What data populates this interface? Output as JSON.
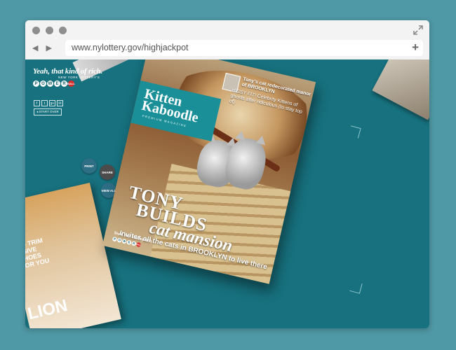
{
  "browser": {
    "url": "www.nylottery.gov/highjackpot",
    "back_icon": "chevron-left-icon",
    "forward_icon": "chevron-right-icon",
    "new_tab_label": "+"
  },
  "brand": {
    "tagline": "Yeah, that kind of rich.",
    "subline": "NEW YORK LOTTERY'S",
    "powerball_letters": [
      "P",
      "O",
      "W",
      "E",
      "R"
    ],
    "ball_label": "BALL",
    "start_over": "◂ START OVER",
    "social": [
      "f",
      "t",
      "g+",
      "✉"
    ]
  },
  "actions": {
    "print": "PRINT",
    "share": "SHARE",
    "view_all": "VIEW ALL"
  },
  "magazine": {
    "title_line1": "Kitten",
    "title_line2": "Kaboodle",
    "title_sub": "PREMIUM MAGAZINE",
    "story1": "Tony's cat redecorated manor of BROOKLYN",
    "story2": "HISSY FIT! Celebrity Kittens of ghosts after ridiculous (to stay top of)",
    "headline1": "TONY",
    "headline2": "BUILDS",
    "headline3": "cat mansion",
    "subhead": "Invites all the cats in BROOKLYN to live there",
    "footer_tag": "Yeah, that kind of rich."
  },
  "left_magazine": {
    "text1": "OU TRIM",
    "text2": "NSIVE",
    "text3": "SHOES",
    "text4": "FOR YOU",
    "big": "LION"
  },
  "colors": {
    "page_bg": "#4f98a5",
    "viewport_bg": "#17717e",
    "magazine_teal": "#1a8f98",
    "powerball_red": "#d92b2b"
  }
}
